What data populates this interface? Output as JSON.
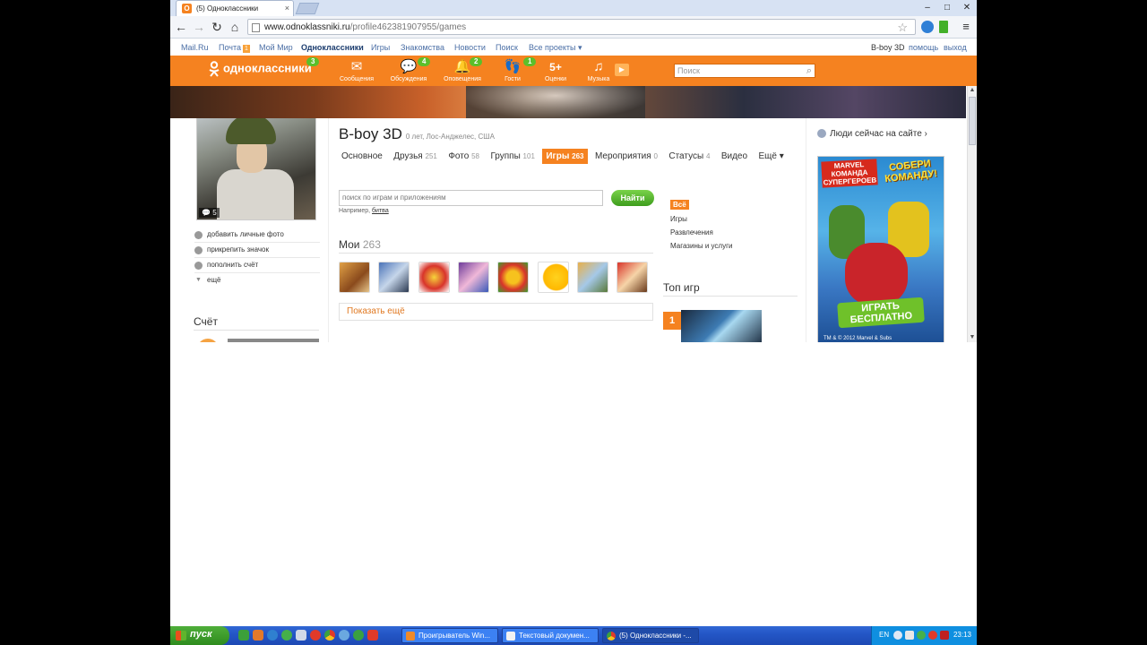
{
  "browser": {
    "tab_title": "(5) Одноклассники",
    "tab_close": "×",
    "url_host": "www.odnoklassniki.ru",
    "url_path": "/profile462381907955/games"
  },
  "portal_bar": {
    "links": [
      "Mail.Ru",
      "Почта",
      "Мой Мир",
      "Одноклассники",
      "Игры",
      "Знакомства",
      "Новости",
      "Поиск",
      "Все проекты ▾"
    ],
    "mail_badge": "1",
    "right_links": [
      "B-boy 3D",
      "помощь",
      "выход"
    ]
  },
  "header": {
    "logo_text": "одноклассники",
    "logo_badge": "3",
    "nav": [
      {
        "label": "Сообщения",
        "icon": "✉",
        "badge": ""
      },
      {
        "label": "Обсуждения",
        "icon": "💬",
        "badge": "4"
      },
      {
        "label": "Оповещения",
        "icon": "🔔",
        "badge": "2"
      },
      {
        "label": "Гости",
        "icon": "👣",
        "badge": "1"
      },
      {
        "label": "Оценки",
        "icon": "5+",
        "badge": ""
      },
      {
        "label": "Музыка",
        "icon": "♫",
        "badge": ""
      }
    ],
    "search_placeholder": "Поиск"
  },
  "profile": {
    "photo_count": "5",
    "name": "B-boy 3D",
    "meta": "0 лет, Лос-Анджелес, США",
    "side_links": [
      "добавить личные фото",
      "прикрепить значок",
      "пополнить счёт",
      "ещё"
    ],
    "score_title": "Счёт"
  },
  "profile_tabs": [
    {
      "label": "Основное",
      "count": ""
    },
    {
      "label": "Друзья",
      "count": "251"
    },
    {
      "label": "Фото",
      "count": "58"
    },
    {
      "label": "Группы",
      "count": "101"
    },
    {
      "label": "Игры",
      "count": "263"
    },
    {
      "label": "Мероприятия",
      "count": "0"
    },
    {
      "label": "Статусы",
      "count": "4"
    },
    {
      "label": "Видео",
      "count": ""
    },
    {
      "label": "Ещё ▾",
      "count": ""
    }
  ],
  "games": {
    "search_placeholder": "поиск по играм и приложениям",
    "find_button": "Найти",
    "example_prefix": "Например,",
    "example_link": "битва",
    "mine_title": "Мои",
    "mine_count": "263",
    "show_more": "Показать ещё",
    "categories": [
      "Всё",
      "Игры",
      "Развлечения",
      "Магазины и услуги"
    ],
    "top_title": "Топ игр",
    "top_rank": "1"
  },
  "right_col": {
    "people_online": "Люди сейчас на сайте ›",
    "ad_title1": "MARVEL КОМАНДА СУПЕРГЕРОЕВ",
    "ad_title2": "СОБЕРИ КОМАНДУ!",
    "ad_play": "ИГРАТЬ БЕСПЛАТНО",
    "ad_footer": "TM & © 2012 Marvel & Subs"
  },
  "taskbar": {
    "start": "пуск",
    "tasks": [
      "Проигрыватель Win...",
      "Текстовый докумен...",
      "(5) Одноклассники -..."
    ],
    "lang": "EN",
    "clock": "23:13"
  }
}
